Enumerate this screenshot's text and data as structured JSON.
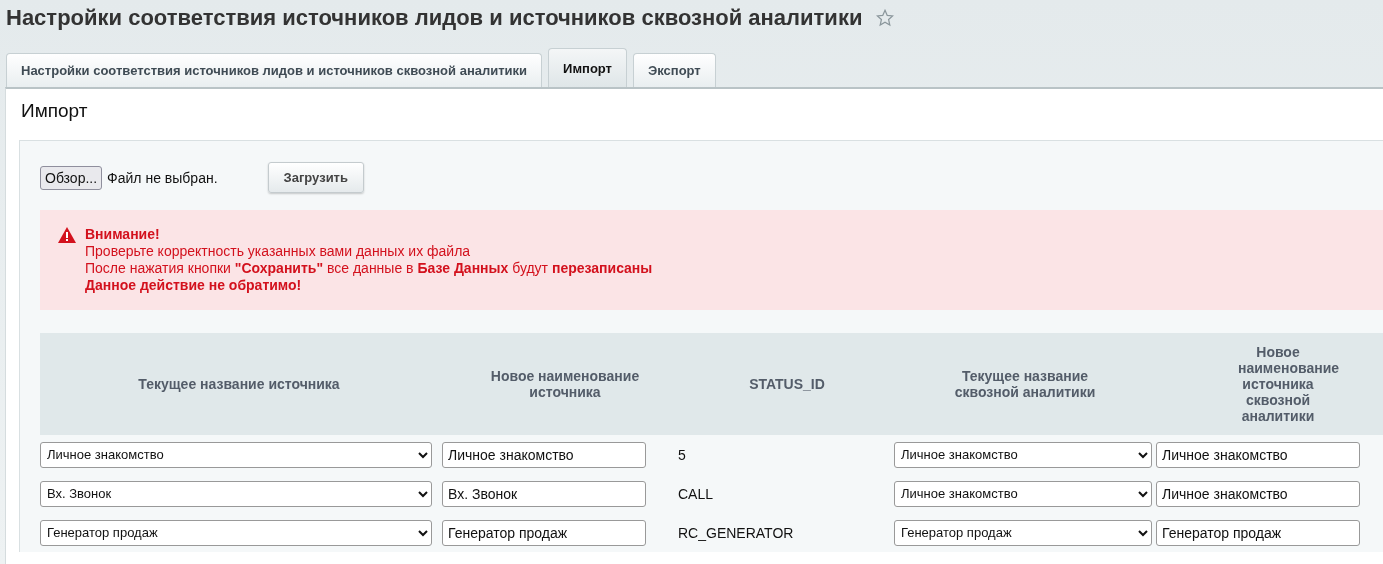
{
  "page_title": "Настройки соответствия источников лидов и источников сквозной аналитики",
  "tabs": [
    {
      "label": "Настройки соответствия источников лидов и источников сквозной аналитики",
      "selected": false
    },
    {
      "label": "Импорт",
      "selected": true
    },
    {
      "label": "Экспорт",
      "selected": false
    }
  ],
  "section_title": "Импорт",
  "file_input": {
    "button": "Обзор...",
    "status": "Файл не выбран."
  },
  "upload_button": "Загрузить",
  "alert": {
    "title": "Внимание!",
    "lines": [
      "Проверьте корректность указанных вами данных их файла",
      "После нажатия кнопки **\"Сохранить\"** все данные в **Базе Данных** будут **перезаписаны**",
      "**Данное действие не обратимо!**"
    ]
  },
  "table": {
    "columns": [
      "Текущее название источника",
      "Новое наименование источника",
      "STATUS_ID",
      "Текущее название сквозной аналитики",
      "Новое наименование источника сквозной аналитики"
    ],
    "rows": [
      {
        "current_source": "Личное знакомство",
        "new_source": "Личное знакомство",
        "status_id": "5",
        "current_analytics": "Личное знакомство",
        "new_analytics": "Личное знакомство"
      },
      {
        "current_source": "Вх. Звонок",
        "new_source": "Вх. Звонок",
        "status_id": "CALL",
        "current_analytics": "Личное знакомство",
        "new_analytics": "Личное знакомство"
      },
      {
        "current_source": "Генератор продаж",
        "new_source": "Генератор продаж",
        "status_id": "RC_GENERATOR",
        "current_analytics": "Генератор продаж",
        "new_analytics": "Генератор продаж"
      }
    ]
  }
}
